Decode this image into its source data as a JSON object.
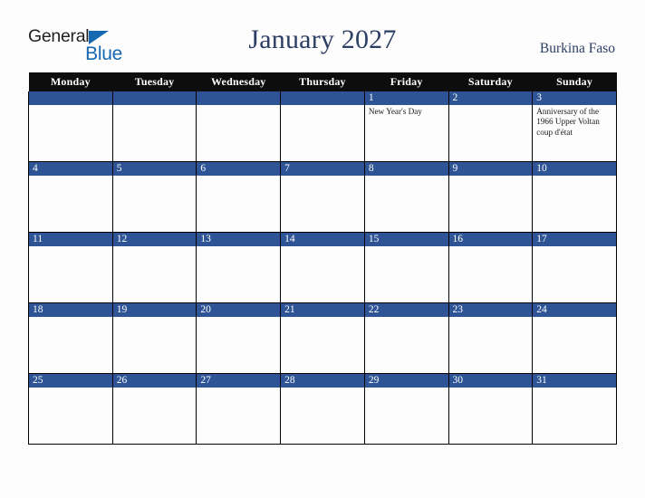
{
  "brand": {
    "word_general": "General",
    "word_blue": "Blue",
    "triangle_color": "#1569b0"
  },
  "header": {
    "title": "January 2027",
    "country": "Burkina Faso"
  },
  "theme": {
    "header_row_bg": "#0d0d0d",
    "date_bar_bg": "#2e5496",
    "title_color": "#2c3e63",
    "page_bg": "#fdfdfd",
    "grid_line": "#000000"
  },
  "calendar": {
    "month": "January",
    "year": "2027",
    "weekday_headers": [
      "Monday",
      "Tuesday",
      "Wednesday",
      "Thursday",
      "Friday",
      "Saturday",
      "Sunday"
    ],
    "weeks": [
      [
        {
          "day": "",
          "event": ""
        },
        {
          "day": "",
          "event": ""
        },
        {
          "day": "",
          "event": ""
        },
        {
          "day": "",
          "event": ""
        },
        {
          "day": "1",
          "event": "New Year's Day"
        },
        {
          "day": "2",
          "event": ""
        },
        {
          "day": "3",
          "event": "Anniversary of the 1966 Upper Voltan coup d'état"
        }
      ],
      [
        {
          "day": "4",
          "event": ""
        },
        {
          "day": "5",
          "event": ""
        },
        {
          "day": "6",
          "event": ""
        },
        {
          "day": "7",
          "event": ""
        },
        {
          "day": "8",
          "event": ""
        },
        {
          "day": "9",
          "event": ""
        },
        {
          "day": "10",
          "event": ""
        }
      ],
      [
        {
          "day": "11",
          "event": ""
        },
        {
          "day": "12",
          "event": ""
        },
        {
          "day": "13",
          "event": ""
        },
        {
          "day": "14",
          "event": ""
        },
        {
          "day": "15",
          "event": ""
        },
        {
          "day": "16",
          "event": ""
        },
        {
          "day": "17",
          "event": ""
        }
      ],
      [
        {
          "day": "18",
          "event": ""
        },
        {
          "day": "19",
          "event": ""
        },
        {
          "day": "20",
          "event": ""
        },
        {
          "day": "21",
          "event": ""
        },
        {
          "day": "22",
          "event": ""
        },
        {
          "day": "23",
          "event": ""
        },
        {
          "day": "24",
          "event": ""
        }
      ],
      [
        {
          "day": "25",
          "event": ""
        },
        {
          "day": "26",
          "event": ""
        },
        {
          "day": "27",
          "event": ""
        },
        {
          "day": "28",
          "event": ""
        },
        {
          "day": "29",
          "event": ""
        },
        {
          "day": "30",
          "event": ""
        },
        {
          "day": "31",
          "event": ""
        }
      ]
    ]
  }
}
